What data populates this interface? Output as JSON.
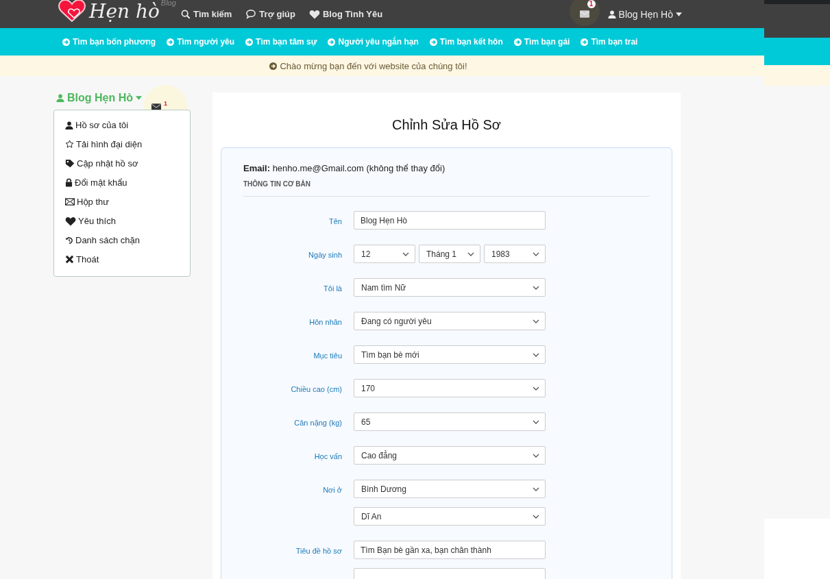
{
  "logo": {
    "text": "Hẹn hò",
    "tag": "Blog"
  },
  "top_nav": [
    {
      "label": "Tìm kiếm"
    },
    {
      "label": "Trợ giúp"
    },
    {
      "label": "Blog Tình Yêu"
    }
  ],
  "account": {
    "mail_badge": "1",
    "user": "Blog Hẹn Hò"
  },
  "category_nav": [
    {
      "label": "Tìm bạn bốn phương"
    },
    {
      "label": "Tìm người yêu"
    },
    {
      "label": "Tìm bạn tâm sự"
    },
    {
      "label": "Người yêu ngắn hạn"
    },
    {
      "label": "Tìm bạn kết hôn"
    },
    {
      "label": "Tìm bạn gái"
    },
    {
      "label": "Tìm bạn trai"
    }
  ],
  "welcome": "Chào mừng bạn đến với website của chúng tôi!",
  "sidebar": {
    "user": "Blog Hẹn Hò",
    "mail_badge": "1",
    "items": [
      {
        "label": "Hồ sơ của tôi"
      },
      {
        "label": "Tải hình đại diện"
      },
      {
        "label": "Cập nhật hồ sơ"
      },
      {
        "label": "Đổi mật khẩu"
      },
      {
        "label": "Hộp thư"
      },
      {
        "label": "Yêu thích"
      },
      {
        "label": "Danh sách chặn"
      },
      {
        "label": "Thoát"
      }
    ]
  },
  "form": {
    "title": "Chỉnh Sửa Hồ Sơ",
    "email_label": "Email:",
    "email": "henho.me@Gmail.com (không thể thay đổi)",
    "section": "THÔNG TIN CƠ BẢN",
    "rows": [
      {
        "label": "Tên",
        "fields": [
          {
            "kind": "input",
            "value": "Blog Hẹn Hò"
          }
        ]
      },
      {
        "label": "Ngày sinh",
        "fields": [
          {
            "kind": "select",
            "value": "12"
          },
          {
            "kind": "select",
            "value": "Tháng 1"
          },
          {
            "kind": "select",
            "value": "1983"
          }
        ]
      },
      {
        "label": "Tôi là",
        "fields": [
          {
            "kind": "select",
            "value": "Nam tìm Nữ"
          }
        ]
      },
      {
        "label": "Hôn nhân",
        "fields": [
          {
            "kind": "select",
            "value": "Đang có người yêu"
          }
        ]
      },
      {
        "label": "Mục tiêu",
        "fields": [
          {
            "kind": "select",
            "value": "Tìm bạn bè mới"
          }
        ]
      },
      {
        "label": "Chiều cao (cm)",
        "fields": [
          {
            "kind": "select",
            "value": "170"
          }
        ]
      },
      {
        "label": "Cân nặng (kg)",
        "fields": [
          {
            "kind": "select",
            "value": "65"
          }
        ]
      },
      {
        "label": "Học vấn",
        "fields": [
          {
            "kind": "select",
            "value": "Cao đẳng"
          }
        ]
      },
      {
        "label": "Nơi ở",
        "fields": [
          {
            "kind": "select",
            "value": "Bình Dương"
          }
        ]
      },
      {
        "fields": [
          {
            "kind": "select",
            "value": "Dĩ An"
          }
        ]
      },
      {
        "label": "Tiêu đề hồ sơ",
        "fields": [
          {
            "kind": "input",
            "value": "Tìm Bạn bè gần xa, bạn chân thành"
          }
        ]
      },
      {
        "fields": [
          {
            "kind": "input"
          }
        ]
      }
    ]
  }
}
